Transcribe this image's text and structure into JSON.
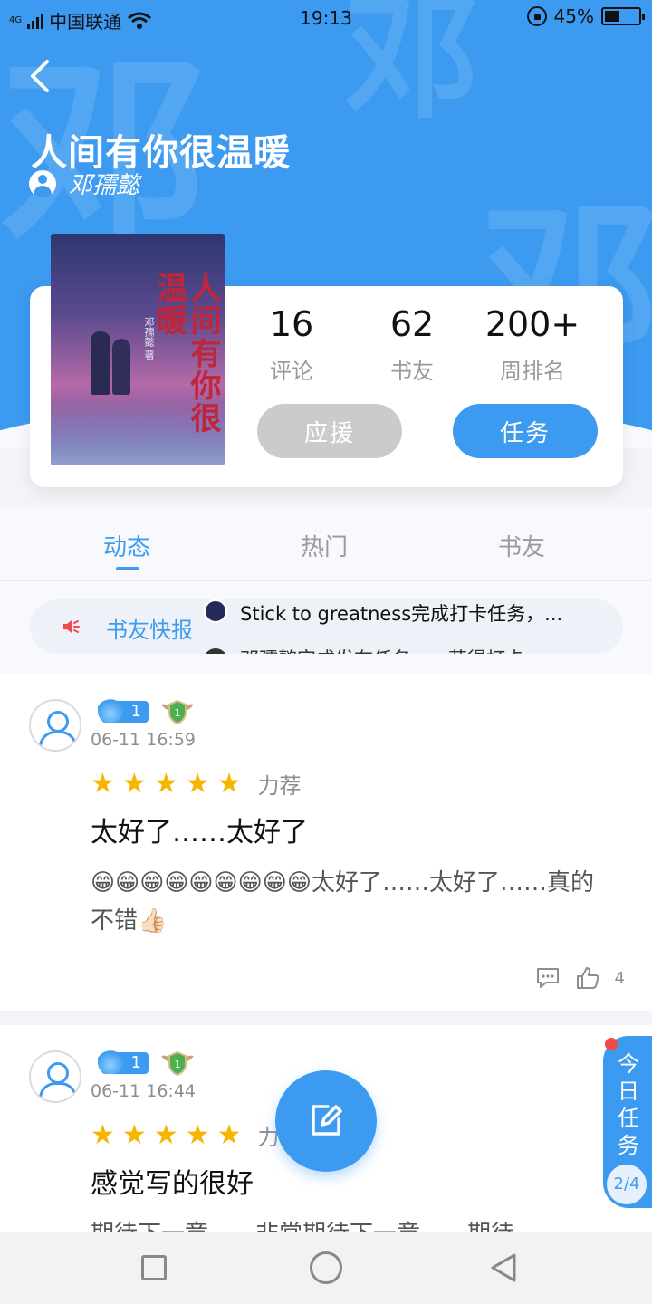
{
  "status_bar": {
    "carrier": "中国联通",
    "network": "4G",
    "time": "19:13",
    "battery": "45%"
  },
  "header": {
    "book_title": "人间有你很温暖",
    "author": "邓孺懿",
    "watermark_char": "邓"
  },
  "cover": {
    "title": "人间有你很温暖",
    "author_small": "邓孺懿 著"
  },
  "stats": [
    {
      "value": "16",
      "label": "评论"
    },
    {
      "value": "62",
      "label": "书友"
    },
    {
      "value": "200+",
      "label": "周排名"
    }
  ],
  "buttons": {
    "cheer": "应援",
    "task": "任务"
  },
  "tabs": [
    {
      "label": "动态",
      "active": true
    },
    {
      "label": "热门",
      "active": false
    },
    {
      "label": "书友",
      "active": false
    }
  ],
  "news": {
    "label": "书友快报",
    "item_1": "Stick to greatness完成打卡任务，...",
    "item_2": "邓孺懿完成发布任务，...获得打卡"
  },
  "posts": [
    {
      "level": "1",
      "time": "06-11 16:59",
      "rating": 5,
      "rating_label": "力荐",
      "title": "太好了……太好了",
      "body": "😁😁😁😁😁😁😁😁😁太好了……太好了……真的不错👍🏻",
      "likes": "4"
    },
    {
      "level": "1",
      "time": "06-11 16:44",
      "rating": 5,
      "rating_label": "力荐",
      "title": "感觉写的很好",
      "body": "期待下一章……非常期待下一章……期待"
    }
  ],
  "side_task": {
    "label": "今日任务",
    "progress": "2/4"
  },
  "colors": {
    "primary": "#3c9af0",
    "star": "#f7b500",
    "badge_red": "#f24848"
  }
}
